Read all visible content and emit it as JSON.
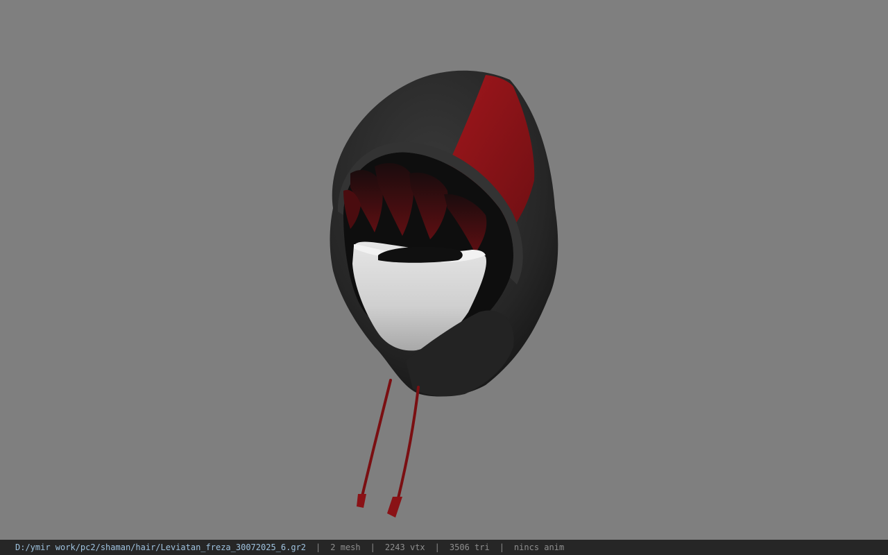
{
  "viewer": {
    "background_color": "#7f7f7f",
    "model_name": "hood-with-mask"
  },
  "status_bar": {
    "file_path": "D:/ymir work/pc2/shaman/hair/Leviatan_freza_30072025_6.gr2",
    "separator": "|",
    "mesh_count": "2 mesh",
    "vertex_count": "2243 vtx",
    "triangle_count": "3506 tri",
    "anim_status": "nincs anim"
  },
  "colors": {
    "hood_dark": "#2a2a2a",
    "hood_red": "#8c1419",
    "mask_white": "#dcdcdc",
    "drawstring_red": "#7a0f12",
    "status_bg": "#262626",
    "path_text": "#9fc3e0"
  }
}
